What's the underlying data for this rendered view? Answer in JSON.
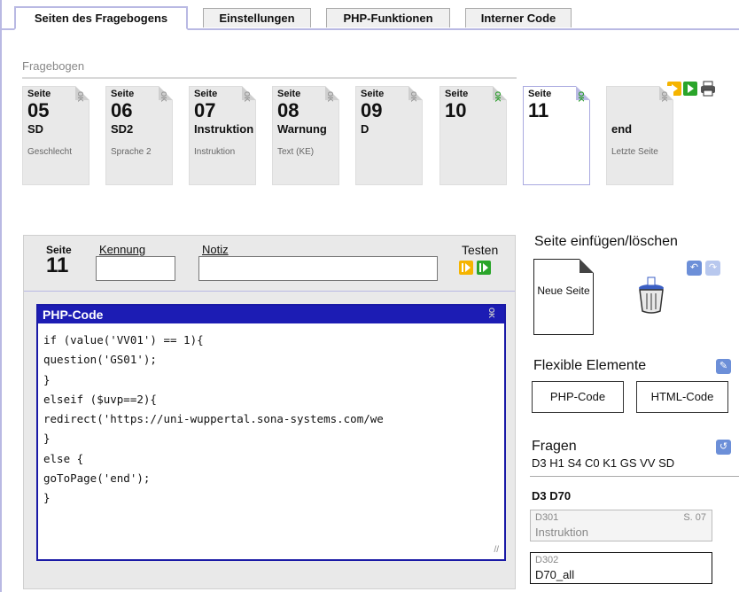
{
  "tabs": [
    "Seiten des Fragebogens",
    "Einstellungen",
    "PHP-Funktionen",
    "Interner Code"
  ],
  "strip": {
    "label": "Fragebogen",
    "pages": [
      {
        "seite": "Seite",
        "num": "05",
        "id": "SD",
        "desc": "Geschlecht",
        "ok": "OK"
      },
      {
        "seite": "Seite",
        "num": "06",
        "id": "SD2",
        "desc": "Sprache 2",
        "ok": "OK"
      },
      {
        "seite": "Seite",
        "num": "07",
        "id": "Instruktion",
        "desc": "Instruktion",
        "ok": "OK"
      },
      {
        "seite": "Seite",
        "num": "08",
        "id": "Warnung",
        "desc": "Text (KE)",
        "ok": "OK"
      },
      {
        "seite": "Seite",
        "num": "09",
        "id": "D",
        "desc": "",
        "ok": "OK"
      },
      {
        "seite": "Seite",
        "num": "10",
        "id": "",
        "desc": "",
        "ok": "OK"
      },
      {
        "seite": "Seite",
        "num": "11",
        "id": "",
        "desc": "",
        "ok": "OK"
      },
      {
        "seite": "",
        "num": "",
        "id": "end",
        "desc": "Letzte Seite",
        "ok": "OK"
      }
    ]
  },
  "editor": {
    "seite_label": "Seite",
    "seite_num": "11",
    "kennung_label": "Kennung",
    "kennung_value": "",
    "notiz_label": "Notiz",
    "notiz_value": "",
    "testen_label": "Testen",
    "code_title": "PHP-Code",
    "code": "if (value('VV01') == 1){\nquestion('GS01');\n}\nelseif ($uvp==2){\nredirect('https://uni-wuppertal.sona-systems.com/we\n}\nelse {\ngoToPage('end');\n}"
  },
  "insert": {
    "title": "Seite einfügen/löschen",
    "new_page": "Neue Seite"
  },
  "flex": {
    "title": "Flexible Elemente",
    "php_button": "PHP-Code",
    "html_button": "HTML-Code"
  },
  "fragen": {
    "title": "Fragen",
    "list": "D3 H1 S4 C0 K1 GS VV SD",
    "group": "D3 D70",
    "items": [
      {
        "code": "D301",
        "seite": "S. 07",
        "name": "Instruktion"
      },
      {
        "code": "D302",
        "seite": "",
        "name": "D70_all"
      }
    ]
  },
  "colors": {
    "accent": "#1c1cb4",
    "tab_line": "#b9b9e3",
    "ok_green": "#2a9d2a",
    "test_yellow": "#f5b400",
    "test_green": "#2aa52a"
  }
}
